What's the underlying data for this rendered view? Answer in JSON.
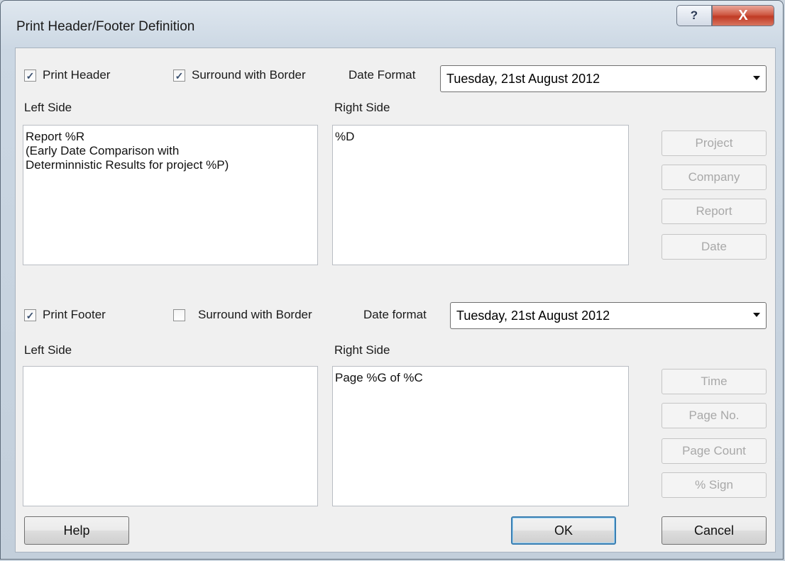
{
  "window": {
    "title": "Print Header/Footer Definition",
    "help_glyph": "?",
    "close_glyph": "X"
  },
  "header": {
    "print_label": "Print Header",
    "print_checked": true,
    "border_label": "Surround with Border",
    "border_checked": true,
    "date_format_label": "Date Format",
    "date_format_value": "Tuesday, 21st August 2012",
    "left_label": "Left Side",
    "right_label": "Right Side",
    "left_text": [
      "Report %R",
      "(Early Date Comparison with",
      "Determinnistic Results for project %P)"
    ],
    "right_text": [
      "%D"
    ]
  },
  "footer": {
    "print_label": "Print Footer",
    "print_checked": true,
    "border_label": "Surround with Border",
    "border_checked": false,
    "date_format_label": "Date format",
    "date_format_value": "Tuesday, 21st August 2012",
    "left_label": "Left Side",
    "right_label": "Right Side",
    "left_text": [],
    "right_text": [
      "Page %G of %C"
    ]
  },
  "header_buttons": [
    "Project",
    "Company",
    "Report",
    "Date"
  ],
  "footer_buttons": [
    "Time",
    "Page No.",
    "Page Count",
    "% Sign"
  ],
  "buttons": {
    "help": "Help",
    "ok": "OK",
    "cancel": "Cancel"
  },
  "colors": {
    "close_button": "#c03a24",
    "default_button_border": "#3c7fb1",
    "disabled_text": "#a8a8a8"
  }
}
